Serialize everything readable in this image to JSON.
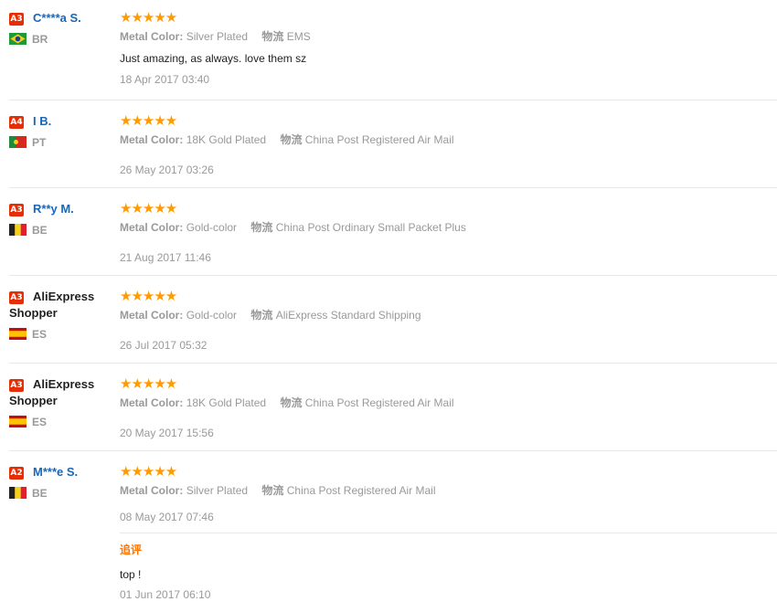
{
  "stars": "★★★★★",
  "labels": {
    "metal_color": "Metal Color:",
    "logistics": "物流"
  },
  "colors": {
    "badge": "#e62e04",
    "stars": "#ff9a00",
    "username_blue": "#1a66b8",
    "append_title": "#ff7300"
  },
  "reviews": [
    {
      "badge": "A3",
      "name": "C****a S.",
      "country": "BR",
      "flag": "brazil-flag-icon",
      "rating": 5,
      "metal_color": "Silver Plated",
      "shipping": "EMS",
      "comment": "Just amazing, as always. love them sz",
      "date": "18 Apr 2017 03:40"
    },
    {
      "badge": "A4",
      "name": "I B.",
      "country": "PT",
      "flag": "portugal-flag-icon",
      "rating": 5,
      "metal_color": "18K Gold Plated",
      "shipping": "China Post Registered Air Mail",
      "comment": "",
      "date": "26 May 2017 03:26"
    },
    {
      "badge": "A3",
      "name": "R**y M.",
      "country": "BE",
      "flag": "belgium-flag-icon",
      "rating": 5,
      "metal_color": "Gold-color",
      "shipping": "China Post Ordinary Small Packet Plus",
      "comment": "",
      "date": "21 Aug 2017 11:46"
    },
    {
      "badge": "A3",
      "name": "AliExpress Shopper",
      "country": "ES",
      "flag": "spain-flag-icon",
      "rating": 5,
      "metal_color": "Gold-color",
      "shipping": "AliExpress Standard Shipping",
      "comment": "",
      "date": "26 Jul 2017 05:32"
    },
    {
      "badge": "A3",
      "name": "AliExpress Shopper",
      "country": "ES",
      "flag": "spain-flag-icon",
      "rating": 5,
      "metal_color": "18K Gold Plated",
      "shipping": "China Post Registered Air Mail",
      "comment": "",
      "date": "20 May 2017 15:56"
    },
    {
      "badge": "A2",
      "name": "M***e S.",
      "country": "BE",
      "flag": "belgium-flag-icon",
      "rating": 5,
      "metal_color": "Silver Plated",
      "shipping": "China Post Registered Air Mail",
      "comment": "",
      "date": "08 May 2017 07:46",
      "append": {
        "title": "追评",
        "comment": "top !",
        "date": "01 Jun 2017 06:10"
      }
    }
  ]
}
